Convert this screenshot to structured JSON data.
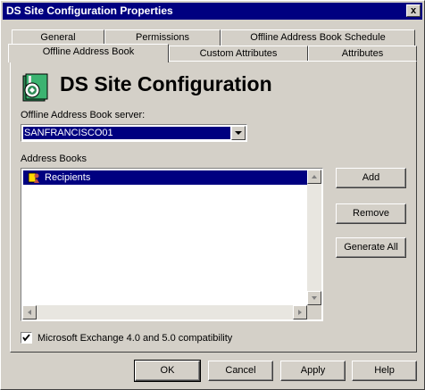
{
  "window": {
    "title": "DS Site Configuration Properties",
    "close_glyph": "x"
  },
  "tabs": {
    "row_back": [
      "General",
      "Permissions",
      "Offline Address Book Schedule"
    ],
    "row_front": [
      "Offline Address Book",
      "Custom Attributes",
      "Attributes"
    ],
    "active": "Offline Address Book"
  },
  "header": {
    "title": "DS Site Configuration",
    "icon": "ds-site-config-icon"
  },
  "server": {
    "label": "Offline Address Book server:",
    "value": "SANFRANCISCO01"
  },
  "address_books": {
    "label": "Address Books",
    "items": [
      {
        "label": "Recipients",
        "icon": "recipients-icon",
        "selected": true
      }
    ]
  },
  "side_buttons": {
    "add": "Add",
    "remove": "Remove",
    "generate_all": "Generate All"
  },
  "compat": {
    "label": "Microsoft Exchange 4.0 and 5.0 compatibility",
    "checked": true
  },
  "footer": {
    "ok": "OK",
    "cancel": "Cancel",
    "apply": "Apply",
    "help": "Help"
  },
  "colors": {
    "title_bar": "#000080",
    "face": "#d4d0c8",
    "selection": "#000080"
  }
}
